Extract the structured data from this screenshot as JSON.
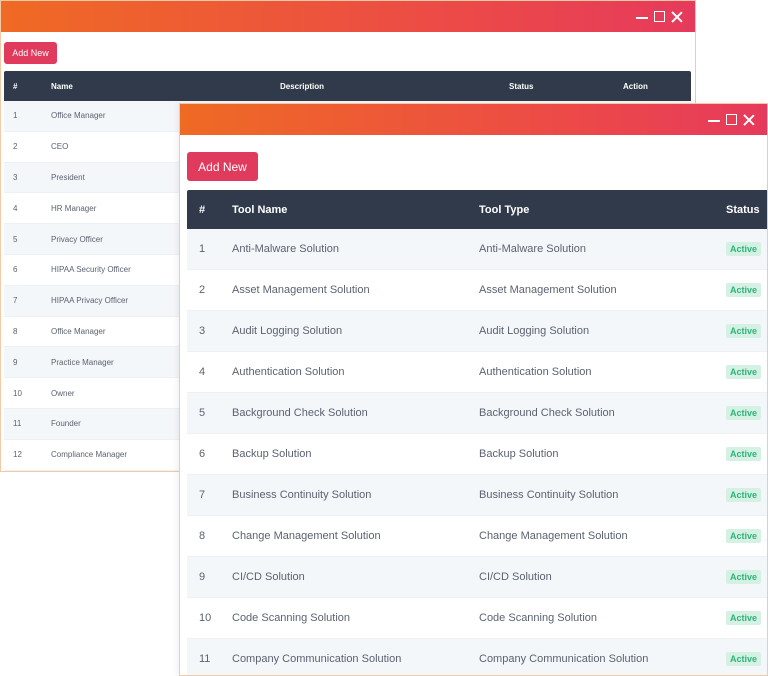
{
  "colors": {
    "titlebar_start": "#ef6a24",
    "titlebar_end": "#e63a5c",
    "accent": "#e03a5c",
    "table_header": "#303a4a",
    "status_active": "#2fb37a"
  },
  "back_window": {
    "add_button": "Add New",
    "columns": [
      "#",
      "Name",
      "Description",
      "Status",
      "Action"
    ],
    "rows": [
      {
        "num": "1",
        "name": "Office Manager"
      },
      {
        "num": "2",
        "name": "CEO"
      },
      {
        "num": "3",
        "name": "President"
      },
      {
        "num": "4",
        "name": "HR Manager"
      },
      {
        "num": "5",
        "name": "Privacy Officer"
      },
      {
        "num": "6",
        "name": "HIPAA Security Officer"
      },
      {
        "num": "7",
        "name": "HIPAA Privacy Officer"
      },
      {
        "num": "8",
        "name": "Office Manager"
      },
      {
        "num": "9",
        "name": "Practice Manager"
      },
      {
        "num": "10",
        "name": "Owner"
      },
      {
        "num": "11",
        "name": "Founder"
      },
      {
        "num": "12",
        "name": "Compliance Manager"
      }
    ]
  },
  "front_window": {
    "add_button": "Add New",
    "columns": [
      "#",
      "Tool Name",
      "Tool Type",
      "Status"
    ],
    "rows": [
      {
        "num": "1",
        "name": "Anti-Malware Solution",
        "type": "Anti-Malware Solution",
        "status": "Active"
      },
      {
        "num": "2",
        "name": "Asset Management Solution",
        "type": "Asset Management Solution",
        "status": "Active"
      },
      {
        "num": "3",
        "name": "Audit Logging Solution",
        "type": "Audit Logging Solution",
        "status": "Active"
      },
      {
        "num": "4",
        "name": "Authentication Solution",
        "type": "Authentication Solution",
        "status": "Active"
      },
      {
        "num": "5",
        "name": "Background Check Solution",
        "type": "Background Check Solution",
        "status": "Active"
      },
      {
        "num": "6",
        "name": "Backup Solution",
        "type": "Backup Solution",
        "status": "Active"
      },
      {
        "num": "7",
        "name": "Business Continuity Solution",
        "type": "Business Continuity Solution",
        "status": "Active"
      },
      {
        "num": "8",
        "name": "Change Management Solution",
        "type": "Change Management Solution",
        "status": "Active"
      },
      {
        "num": "9",
        "name": "CI/CD Solution",
        "type": "CI/CD Solution",
        "status": "Active"
      },
      {
        "num": "10",
        "name": "Code Scanning Solution",
        "type": "Code Scanning Solution",
        "status": "Active"
      },
      {
        "num": "11",
        "name": "Company Communication Solution",
        "type": "Company Communication Solution",
        "status": "Active"
      }
    ]
  }
}
